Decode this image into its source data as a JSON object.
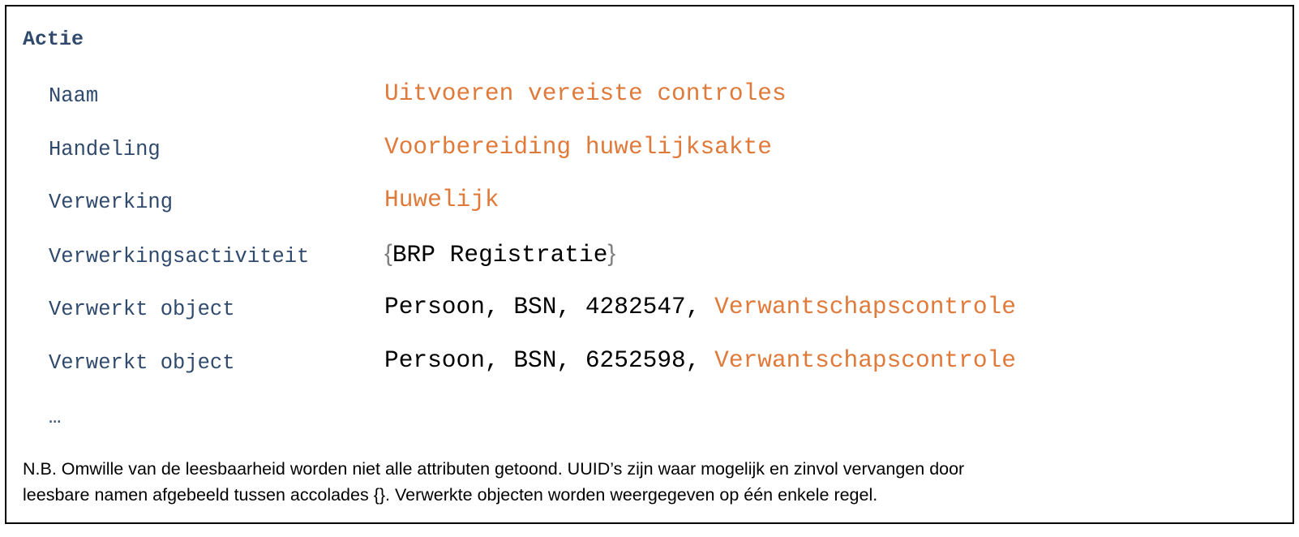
{
  "title": "Actie",
  "rows": [
    {
      "label": "Naam",
      "value": "Uitvoeren vereiste controles"
    },
    {
      "label": "Handeling",
      "value": "Voorbereiding huwelijksakte"
    },
    {
      "label": "Verwerking",
      "value": "Huwelijk"
    },
    {
      "label": "Verwerkingsactiviteit",
      "brace_open": "{",
      "value": "BRP Registratie",
      "brace_close": "}"
    },
    {
      "label": "Verwerkt object",
      "prefix": "Persoon, BSN, 4282547, ",
      "value": "Verwantschapscontrole"
    },
    {
      "label": "Verwerkt object",
      "prefix": "Persoon, BSN, 6252598, ",
      "value": "Verwantschapscontrole"
    }
  ],
  "ellipsis": "…",
  "note": {
    "line1": "N.B. Omwille van de leesbaarheid worden niet alle attributen getoond. UUID’s zijn waar mogelijk en zinvol vervangen door",
    "line2": "leesbare namen afgebeeld tussen accolades {}. Verwerkte objecten worden weergegeven op één enkele regel."
  },
  "colors": {
    "label": "#2f4a6d",
    "highlight": "#e07a3a",
    "brace": "#808080"
  }
}
